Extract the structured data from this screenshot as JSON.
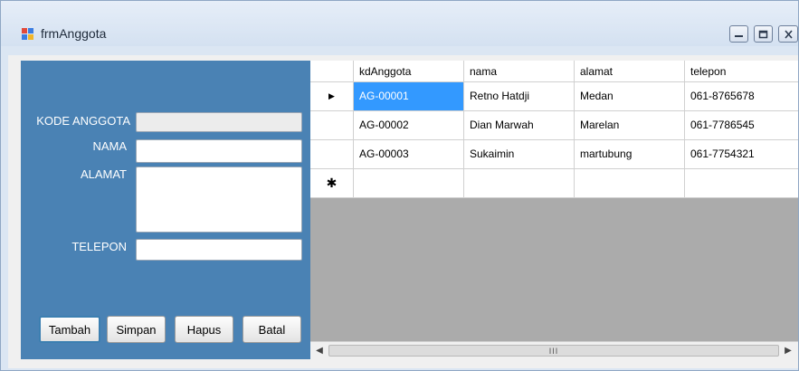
{
  "window": {
    "title": "frmAnggota"
  },
  "form": {
    "kode_label": "KODE ANGGOTA",
    "kode_value": "",
    "nama_label": "NAMA",
    "nama_value": "",
    "alamat_label": "ALAMAT",
    "alamat_value": "",
    "telepon_label": "TELEPON",
    "telepon_value": ""
  },
  "buttons": {
    "tambah": "Tambah",
    "simpan": "Simpan",
    "hapus": "Hapus",
    "batal": "Batal"
  },
  "grid": {
    "columns": [
      "kdAnggota",
      "nama",
      "alamat",
      "telepon"
    ],
    "rows": [
      {
        "kdAnggota": "AG-00001",
        "nama": "Retno Hatdji",
        "alamat": "Medan",
        "telepon": "061-8765678"
      },
      {
        "kdAnggota": "AG-00002",
        "nama": "Dian Marwah",
        "alamat": "Marelan",
        "telepon": "061-7786545"
      },
      {
        "kdAnggota": "AG-00003",
        "nama": "Sukaimin",
        "alamat": "martubung",
        "telepon": "061-7754321"
      }
    ],
    "current_row_marker": "▶",
    "new_row_marker": "✱",
    "selected_cell": "AG-00001"
  },
  "scrollbar": {
    "left_arrow": "◀",
    "right_arrow": "▶",
    "thumb_grip": "III"
  },
  "colors": {
    "panel": "#4a82b4",
    "selection": "#3399ff",
    "grid_background": "#ababab"
  }
}
